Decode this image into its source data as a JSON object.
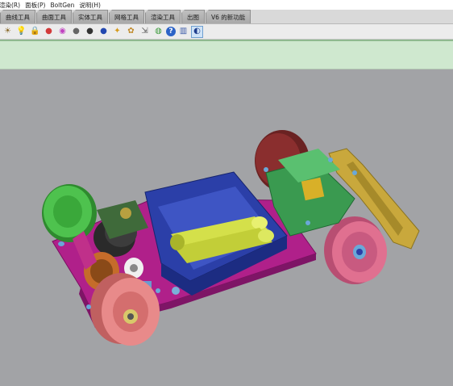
{
  "menu": {
    "items": [
      "渲染(R)",
      "面板(P)",
      "BoltGen",
      "说明(H)"
    ]
  },
  "tabs": [
    {
      "label": "曲线工具",
      "active": false
    },
    {
      "label": "曲面工具",
      "active": false
    },
    {
      "label": "实体工具",
      "active": false
    },
    {
      "label": "网格工具",
      "active": false
    },
    {
      "label": "渲染工具",
      "active": false
    },
    {
      "label": "出图",
      "active": false
    },
    {
      "label": "V6 的新功能",
      "active": false
    }
  ],
  "toolbar": {
    "buttons": [
      {
        "icon": "camera-icon",
        "glyph": "☀"
      },
      {
        "icon": "light-bulb-icon",
        "glyph": "💡"
      },
      {
        "icon": "lock-icon",
        "glyph": "🔒"
      },
      {
        "icon": "red-sphere-icon",
        "glyph": "●"
      },
      {
        "icon": "color-wheel-icon",
        "glyph": "◉"
      },
      {
        "icon": "material-sphere-icon",
        "glyph": "●"
      },
      {
        "icon": "dark-sphere-icon",
        "glyph": "●"
      },
      {
        "icon": "blue-sphere-icon",
        "glyph": "●"
      },
      {
        "icon": "spotlight-icon",
        "glyph": "✦"
      },
      {
        "icon": "texture-icon",
        "glyph": "✿"
      },
      {
        "icon": "mapping-icon",
        "glyph": "⇲"
      },
      {
        "icon": "environment-icon",
        "glyph": "◍"
      },
      {
        "icon": "help-icon",
        "glyph": "?"
      },
      {
        "icon": "ground-plane-icon",
        "glyph": "▥"
      },
      {
        "icon": "render-icon",
        "glyph": "◐"
      }
    ]
  },
  "colors": {
    "command_area": "#cfe8cf",
    "viewport_bg": "#a2a3a6",
    "chassis": "#b0208a",
    "wheel_green": "#4ec24e",
    "wheel_pink": "#e07090",
    "wheel_salmon": "#e88a8a",
    "battery_box": "#2b3fa8",
    "battery": "#d4e04a",
    "arm": "#c9a83c"
  }
}
